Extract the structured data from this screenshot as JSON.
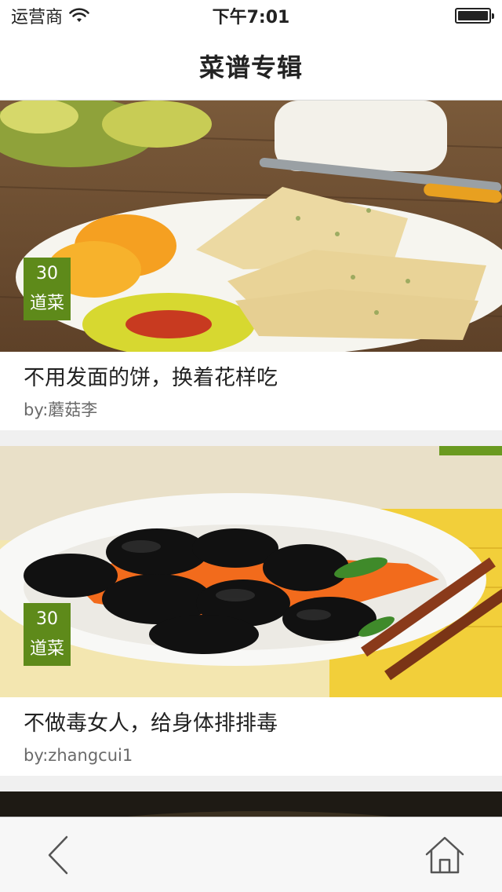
{
  "status_bar": {
    "carrier": "运营商",
    "time": "下午7:01",
    "wifi_icon": "wifi-icon",
    "battery_icon": "battery-icon"
  },
  "nav": {
    "title": "菜谱专辑"
  },
  "cards": [
    {
      "count": "30",
      "count_unit": "道菜",
      "title": "不用发面的饼，换着花样吃",
      "author": "by:蘑菇李",
      "image_subject": "pancake-plate-photo"
    },
    {
      "count": "30",
      "count_unit": "道菜",
      "title": "不做毒女人，给身体排排毒",
      "author": "by:zhangcui1",
      "image_subject": "wood-ear-mushroom-photo"
    }
  ],
  "toolbar": {
    "back_icon": "chevron-left-icon",
    "home_icon": "home-icon"
  },
  "colors": {
    "badge": "#5e8a1a",
    "background": "#f0f0f0"
  }
}
